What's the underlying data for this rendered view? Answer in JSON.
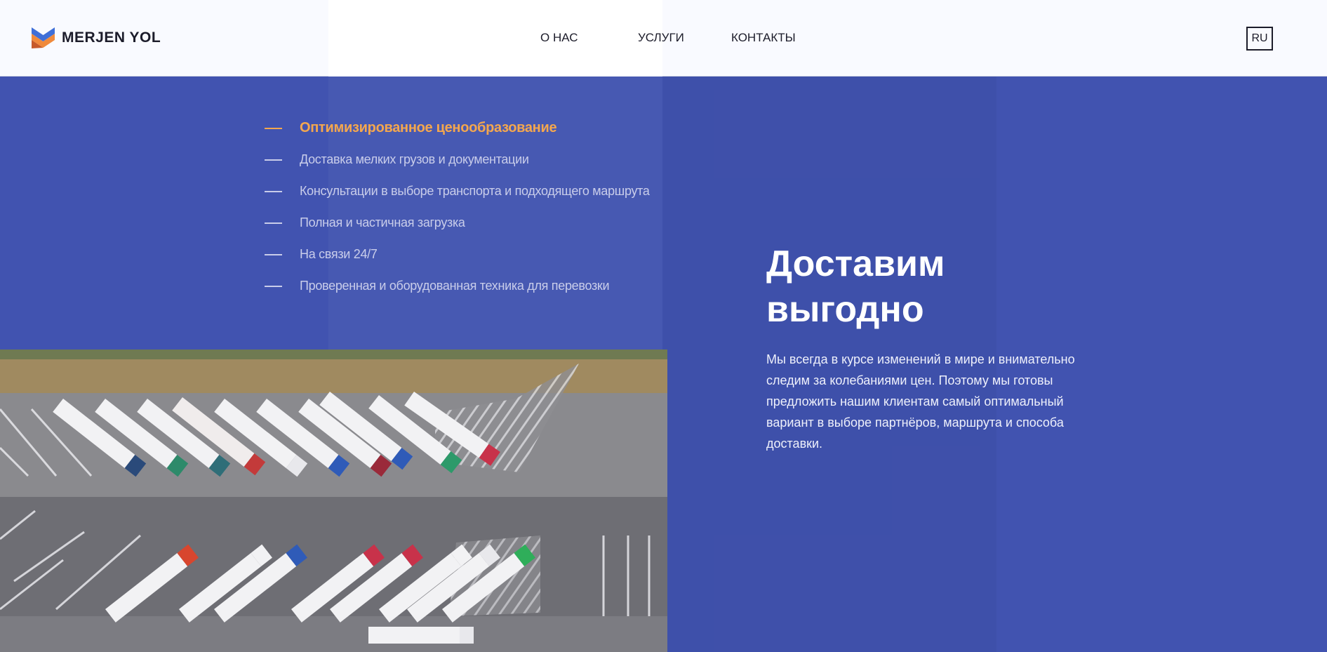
{
  "header": {
    "logo_text": "MERJEN YOL",
    "nav": [
      "О НАС",
      "УСЛУГИ",
      "КОНТАКТЫ"
    ],
    "lang": "RU"
  },
  "features": [
    "Оптимизированное ценообразование",
    "Доставка мелких грузов и документации",
    "Консультации в выборе транспорта и подходящего маршрута",
    "Полная и частичная загрузка",
    "На связи 24/7",
    "Проверенная и оборудованная техника для перевозки"
  ],
  "hero": {
    "title": "Доставим выгодно",
    "description": "Мы всегда в курсе изменений в мире и внимательно следим за колебаниями цен. Поэтому мы готовы предложить нашим клиентам самый оптимальный вариант в выборе партнёров, маршрута и способа доставки."
  },
  "colors": {
    "background": "#4153b0",
    "accent": "#f4a74e",
    "header_bg": "#f9faff"
  },
  "icons": [
    "logo-mark-icon"
  ]
}
